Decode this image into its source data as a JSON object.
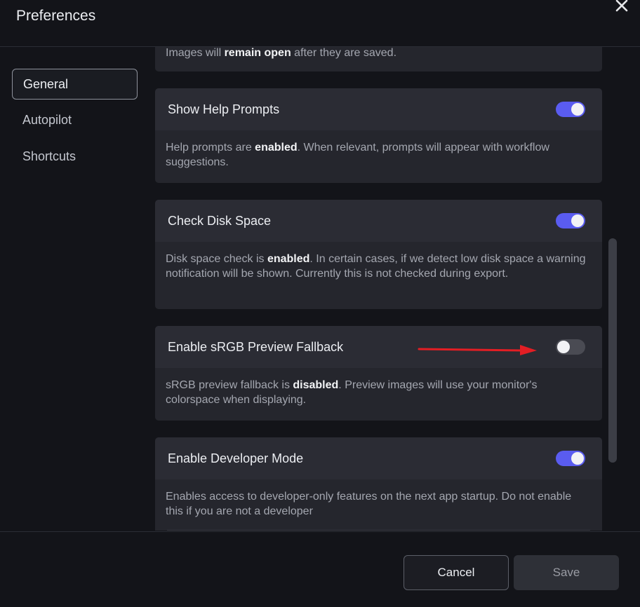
{
  "dialog": {
    "title": "Preferences"
  },
  "nav": {
    "items": [
      {
        "label": "General",
        "active": true
      },
      {
        "label": "Autopilot",
        "active": false
      },
      {
        "label": "Shortcuts",
        "active": false
      }
    ]
  },
  "settings": {
    "partial_prefix": "Images will ",
    "partial_bold": "remain open",
    "partial_suffix": " after they are saved.",
    "items": [
      {
        "title": "Show Help Prompts",
        "enabled": true,
        "desc_prefix": "Help prompts are ",
        "desc_bold": "enabled",
        "desc_suffix": ". When relevant, prompts will appear with workflow suggestions."
      },
      {
        "title": "Check Disk Space",
        "enabled": true,
        "desc_prefix": "Disk space check is ",
        "desc_bold": "enabled",
        "desc_suffix": ". In certain cases, if we detect low disk space a warning notification will be shown. Currently this is not checked during export."
      },
      {
        "title": "Enable sRGB Preview Fallback",
        "enabled": false,
        "desc_prefix": "sRGB preview fallback is ",
        "desc_bold": "disabled",
        "desc_suffix": ". Preview images will use your monitor's colorspace when displaying."
      },
      {
        "title": "Enable Developer Mode",
        "enabled": true,
        "desc_prefix": "Enables access to developer-only features on the next app startup. Do not enable this if you are not a developer",
        "desc_bold": "",
        "desc_suffix": ""
      }
    ]
  },
  "footer": {
    "cancel_label": "Cancel",
    "save_label": "Save"
  },
  "colors": {
    "accent": "#5a5cf0",
    "annotation_arrow": "#e31e24",
    "background": "#131419",
    "card": "#25262d"
  },
  "icons": {
    "close": "close-icon",
    "annotation": "arrow-right-icon"
  }
}
